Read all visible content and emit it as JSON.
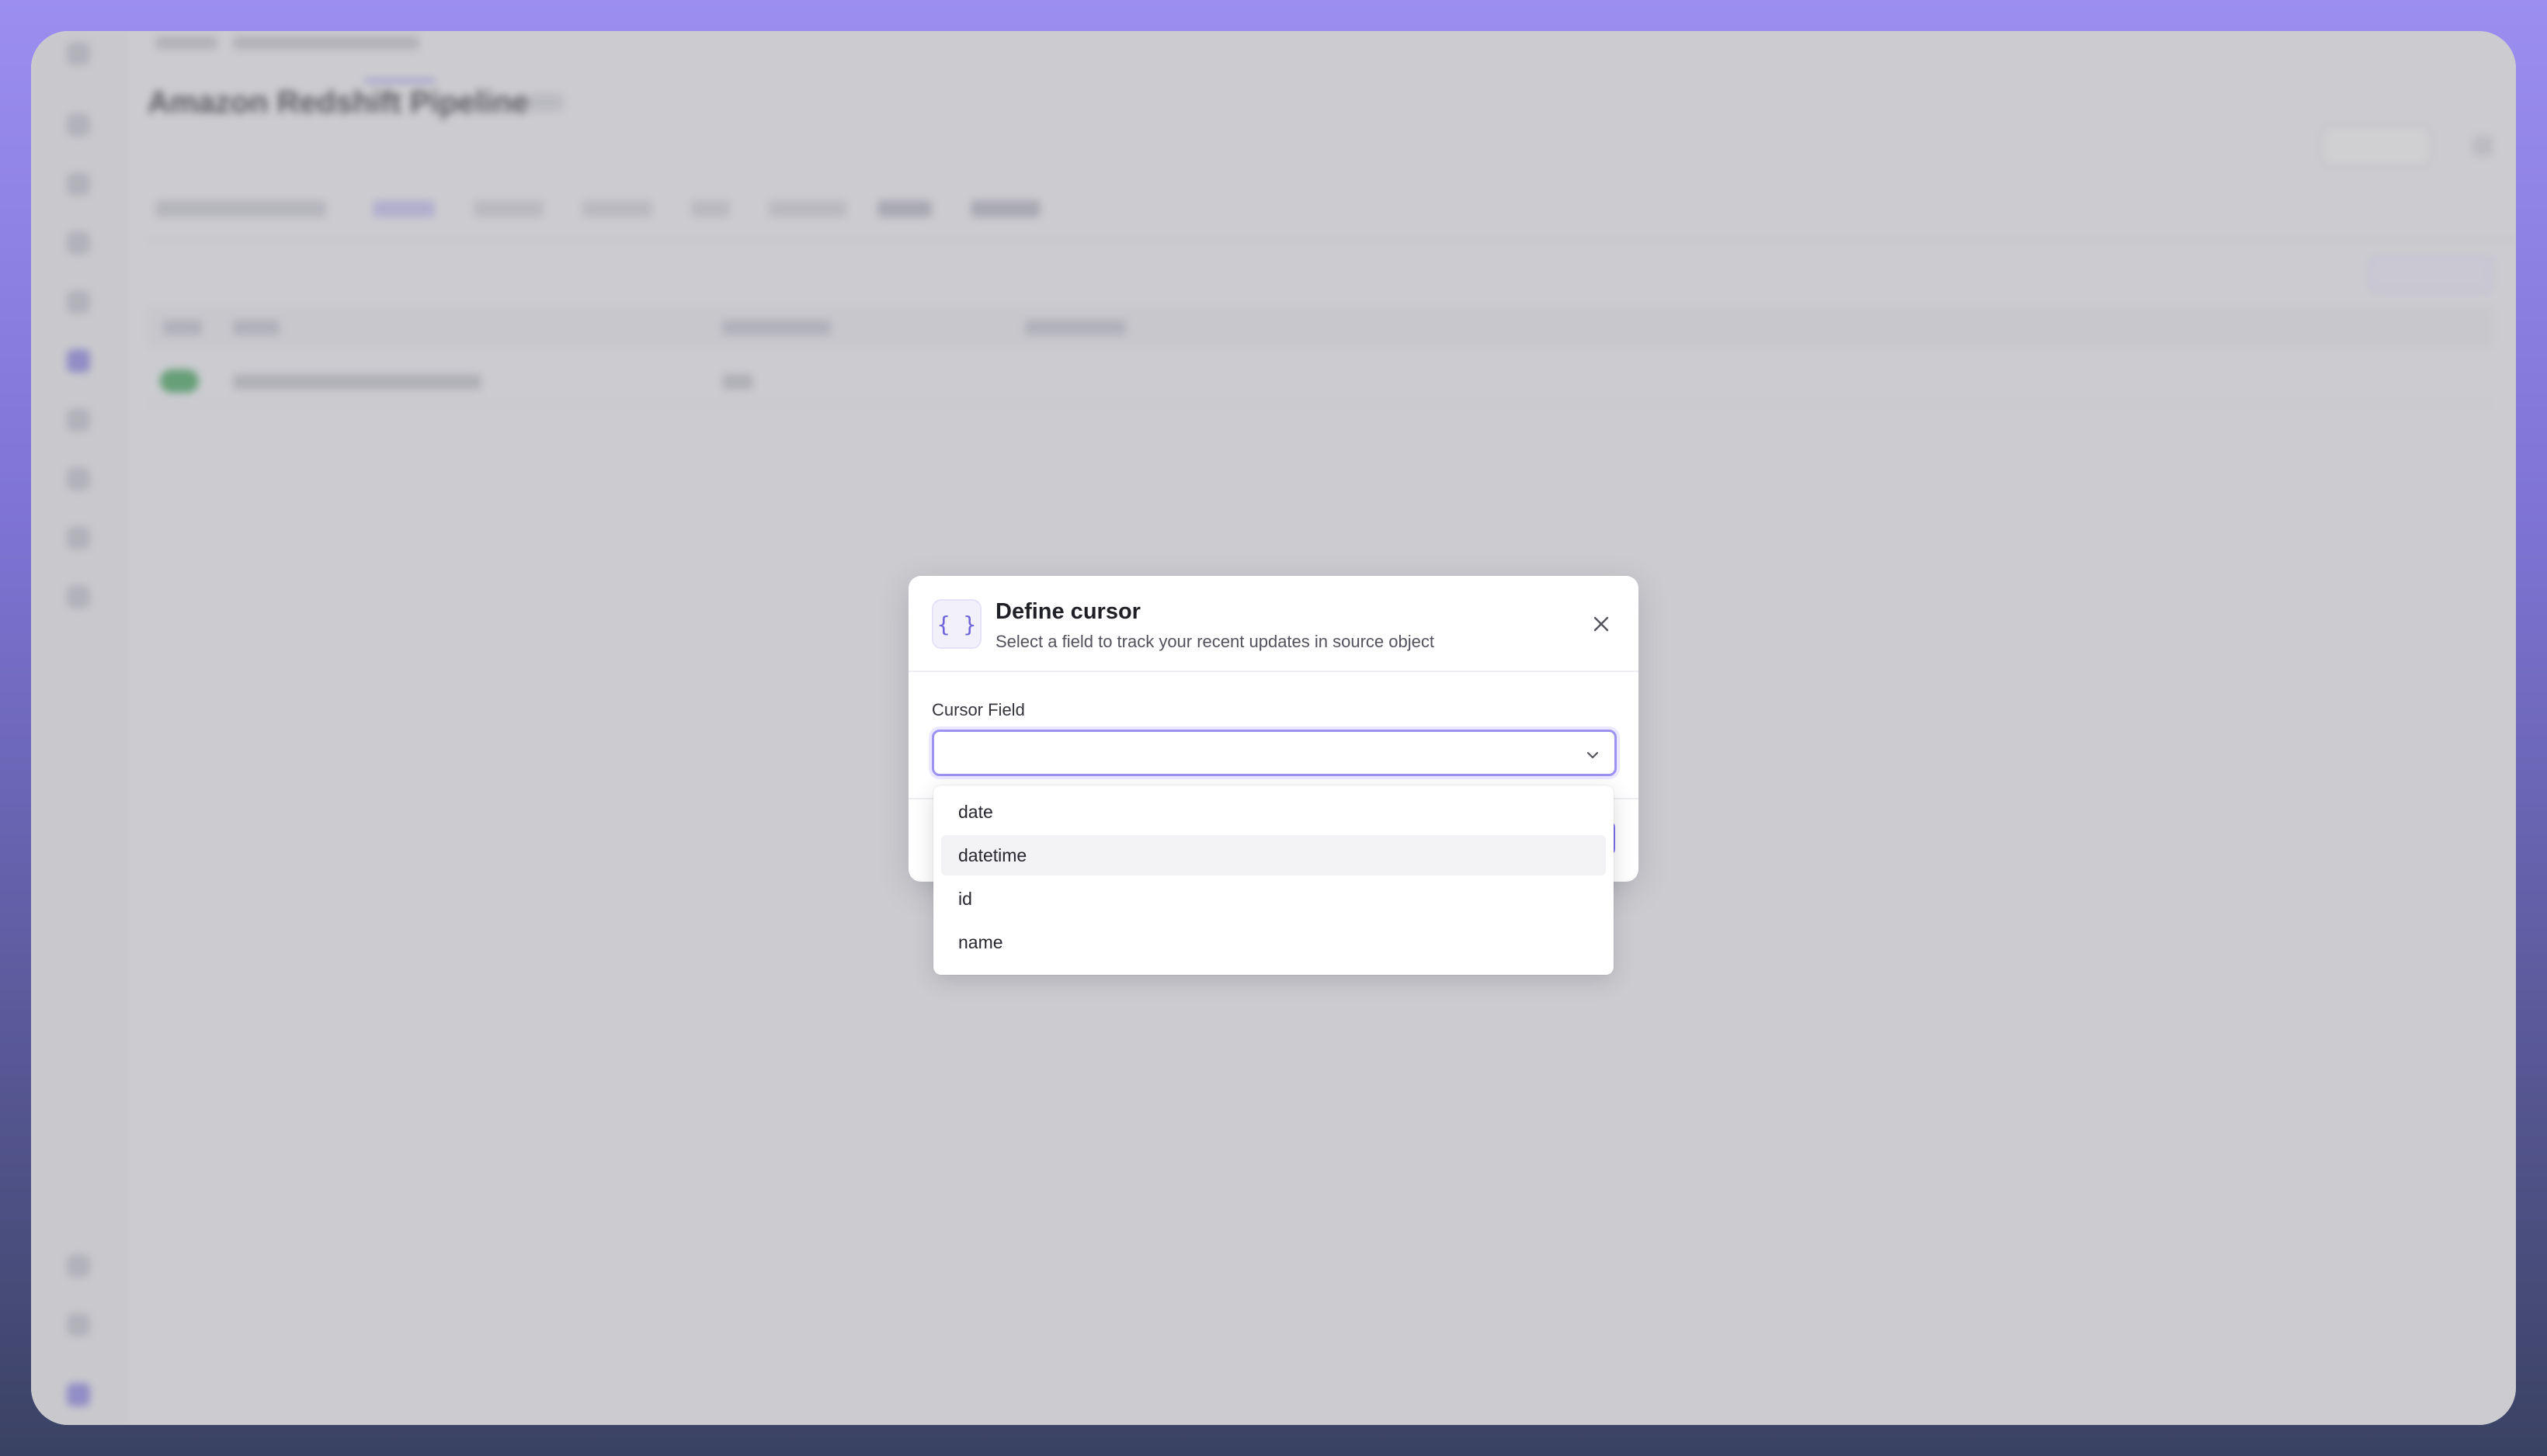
{
  "background_app": {
    "page_title": "Amazon Redshift Pipeline",
    "page_subtitle": "",
    "tabs": [
      {
        "label": "",
        "active": false
      },
      {
        "label": "",
        "active": true
      },
      {
        "label": "",
        "active": false
      },
      {
        "label": "",
        "active": false
      },
      {
        "label": "",
        "active": false
      },
      {
        "label": "",
        "active": false
      },
      {
        "label": "",
        "active": false
      },
      {
        "label": "",
        "active": false
      }
    ]
  },
  "modal": {
    "icon": "curly-braces-icon",
    "icon_glyph": "{ }",
    "title": "Define cursor",
    "subtitle": "Select a field to track your recent updates in source object",
    "close_icon": "close-icon",
    "field_label": "Cursor Field",
    "select_value": "",
    "chevron_icon": "chevron-down-icon"
  },
  "dropdown": {
    "options": [
      {
        "label": "date",
        "hovered": false
      },
      {
        "label": "datetime",
        "hovered": true
      },
      {
        "label": "id",
        "hovered": false
      },
      {
        "label": "name",
        "hovered": false
      }
    ]
  },
  "colors": {
    "accent": "#7c6ff0",
    "success": "#3fa65a"
  }
}
